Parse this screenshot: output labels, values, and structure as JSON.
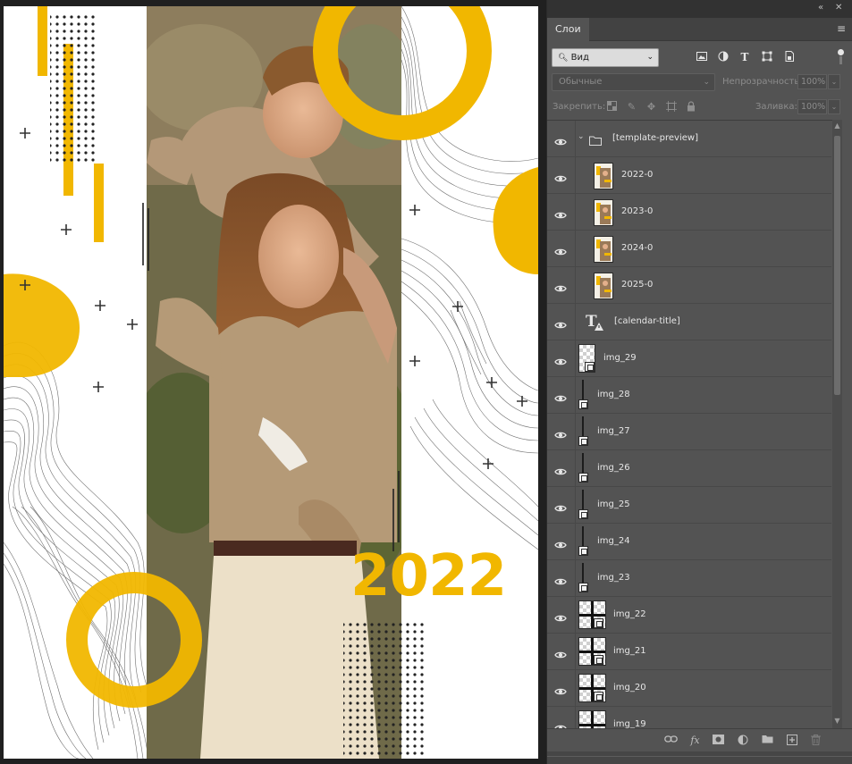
{
  "canvas": {
    "year_text": "2022",
    "accent_color": "#f1b700",
    "photo_description_icon": "photo-of-mother-and-child"
  },
  "panel": {
    "title_tab": "Слои",
    "collapse_icon": "double-chevron-left-icon",
    "close_icon": "close-icon",
    "menu_icon": "hamburger-menu-icon",
    "filter": {
      "value": "Вид",
      "icon": "search-icon"
    },
    "filter_icons": [
      "image-filter-icon",
      "adjustment-filter-icon",
      "type-filter-icon",
      "shape-filter-icon",
      "smart-object-filter-icon"
    ],
    "blend_mode": "Обычные",
    "opacity_label": "Непрозрачность:",
    "opacity_value": "100%",
    "lock_label": "Закрепить:",
    "fill_label": "Заливка:",
    "fill_value": "100%",
    "lock_icons": [
      "lock-transparent-pixels-icon",
      "lock-image-pixels-icon",
      "lock-position-icon",
      "lock-artboard-icon",
      "lock-all-icon"
    ]
  },
  "layers": [
    {
      "name": "[template-preview]",
      "kind": "group"
    },
    {
      "name": "2022-0",
      "kind": "photo"
    },
    {
      "name": "2023-0",
      "kind": "photo"
    },
    {
      "name": "2024-0",
      "kind": "photo"
    },
    {
      "name": "2025-0",
      "kind": "photo"
    },
    {
      "name": "[calendar-title]",
      "kind": "text"
    },
    {
      "name": "img_29",
      "kind": "smart"
    },
    {
      "name": "img_28",
      "kind": "line"
    },
    {
      "name": "img_27",
      "kind": "line"
    },
    {
      "name": "img_26",
      "kind": "line"
    },
    {
      "name": "img_25",
      "kind": "line"
    },
    {
      "name": "img_24",
      "kind": "line"
    },
    {
      "name": "img_23",
      "kind": "line"
    },
    {
      "name": "img_22",
      "kind": "cross"
    },
    {
      "name": "img_21",
      "kind": "cross"
    },
    {
      "name": "img_20",
      "kind": "cross"
    },
    {
      "name": "img_19",
      "kind": "cross"
    }
  ],
  "bottom_icons": [
    "link-layers-icon",
    "fx-icon",
    "mask-icon",
    "adjustment-layer-icon",
    "new-group-icon",
    "new-layer-icon",
    "trash-icon"
  ]
}
